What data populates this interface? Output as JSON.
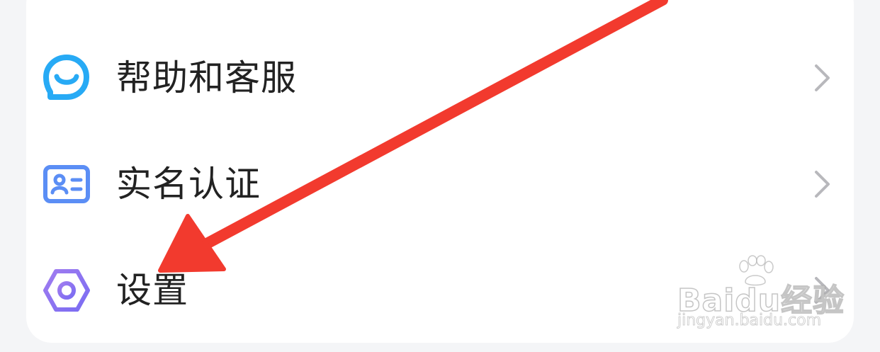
{
  "menu": {
    "items": [
      {
        "label": "帮助和客服",
        "icon": "chat-bubble-smile-icon"
      },
      {
        "label": "实名认证",
        "icon": "id-card-icon"
      },
      {
        "label": "设置",
        "icon": "hexagon-gear-icon"
      }
    ]
  },
  "annotation": {
    "icon": "red-arrow-pointer"
  },
  "watermark": {
    "brand": "Baidu经验",
    "url": "jingyan.baidu.com"
  },
  "colors": {
    "background": "#f4f5f7",
    "card": "#ffffff",
    "help_icon": "#27aaf5",
    "id_icon": "#5b8ef5",
    "settings_icon_start": "#9a7cf0",
    "settings_icon_end": "#7a6cf2",
    "chevron": "#b8b8bc",
    "arrow": "#f23a2e",
    "label": "#222222"
  }
}
